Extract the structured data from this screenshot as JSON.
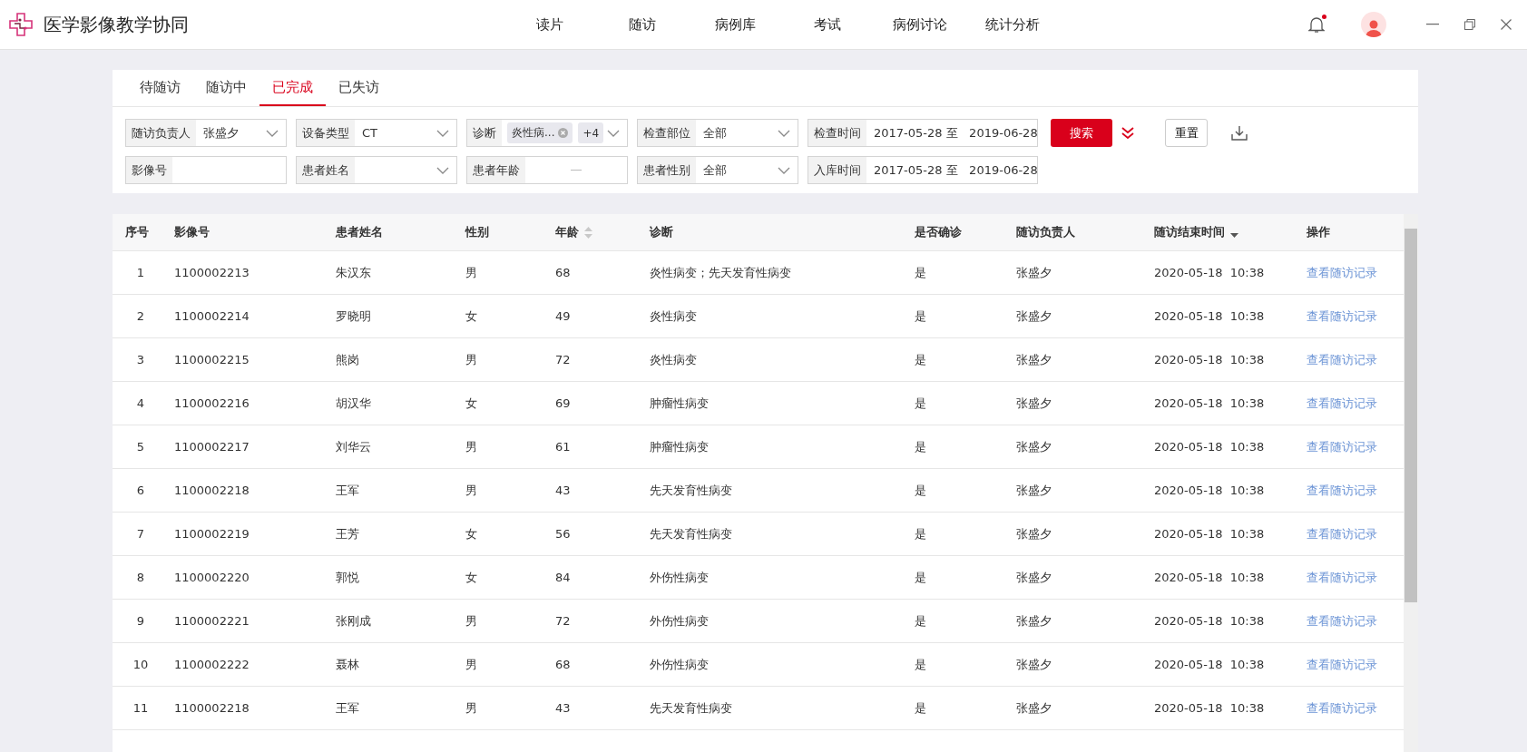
{
  "app": {
    "title": "医学影像教学协同"
  },
  "nav": [
    {
      "label": "读片",
      "selected": false
    },
    {
      "label": "随访",
      "selected": false
    },
    {
      "label": "病例库",
      "selected": false
    },
    {
      "label": "考试",
      "selected": false
    },
    {
      "label": "病例讨论",
      "selected": false
    },
    {
      "label": "统计分析",
      "selected": false
    }
  ],
  "notifications": {
    "unread": true
  },
  "tabs": [
    {
      "label": "待随访",
      "selected": false
    },
    {
      "label": "随访中",
      "selected": false
    },
    {
      "label": "已完成",
      "selected": true
    },
    {
      "label": "已失访",
      "selected": false
    }
  ],
  "filters": [
    [
      {
        "kind": "select",
        "label": "随访负责人",
        "value": "张盛夕"
      },
      {
        "kind": "select",
        "label": "设备类型",
        "value": "CT"
      },
      {
        "kind": "tags",
        "label": "诊断",
        "tags": [
          "炎性病..."
        ],
        "more": "+4"
      },
      {
        "kind": "select",
        "label": "检查部位",
        "value": "全部"
      },
      {
        "kind": "date_range",
        "label": "检查时间",
        "from": "2017-05-28",
        "sep": "至",
        "to": "2019-06-28"
      }
    ],
    [
      {
        "kind": "input",
        "label": "影像号"
      },
      {
        "kind": "select",
        "label": "患者姓名"
      },
      {
        "kind": "range",
        "label": "患者年龄"
      },
      {
        "kind": "select",
        "label": "患者性别",
        "value": "全部"
      },
      {
        "kind": "date_range",
        "label": "入库时间",
        "from": "2017-05-28",
        "sep": "至",
        "to": "2019-06-28"
      }
    ]
  ],
  "actions": {
    "search": "搜索",
    "reset": "重置"
  },
  "table": {
    "columns": [
      {
        "label": "序号",
        "sortable": false
      },
      {
        "label": "影像号",
        "sortable": false
      },
      {
        "label": "患者姓名",
        "sortable": false
      },
      {
        "label": "性别",
        "sortable": false
      },
      {
        "label": "年龄",
        "sortable": true,
        "sorted_desc": false
      },
      {
        "label": "诊断",
        "sortable": false
      },
      {
        "label": "是否确诊",
        "sortable": false
      },
      {
        "label": "随访负责人",
        "sortable": false
      },
      {
        "label": "随访结束时间",
        "sortable": true,
        "sorted_desc": true
      },
      {
        "label": "操作",
        "sortable": false
      }
    ],
    "rows": [
      [
        "1",
        "1100002213",
        "朱汉东",
        "男",
        "68",
        "炎性病变；先天发育性病变",
        "是",
        "张盛夕",
        "2020-05-18  10:38",
        "查看随访记录"
      ],
      [
        "2",
        "1100002214",
        "罗晓明",
        "女",
        "49",
        "炎性病变",
        "是",
        "张盛夕",
        "2020-05-18  10:38",
        "查看随访记录"
      ],
      [
        "3",
        "1100002215",
        "熊岗",
        "男",
        "72",
        "炎性病变",
        "是",
        "张盛夕",
        "2020-05-18  10:38",
        "查看随访记录"
      ],
      [
        "4",
        "1100002216",
        "胡汉华",
        "女",
        "69",
        "肿瘤性病变",
        "是",
        "张盛夕",
        "2020-05-18  10:38",
        "查看随访记录"
      ],
      [
        "5",
        "1100002217",
        "刘华云",
        "男",
        "61",
        "肿瘤性病变",
        "是",
        "张盛夕",
        "2020-05-18  10:38",
        "查看随访记录"
      ],
      [
        "6",
        "1100002218",
        "王军",
        "男",
        "43",
        "先天发育性病变",
        "是",
        "张盛夕",
        "2020-05-18  10:38",
        "查看随访记录"
      ],
      [
        "7",
        "1100002219",
        "王芳",
        "女",
        "56",
        "先天发育性病变",
        "是",
        "张盛夕",
        "2020-05-18  10:38",
        "查看随访记录"
      ],
      [
        "8",
        "1100002220",
        "郭悦",
        "女",
        "84",
        "外伤性病变",
        "是",
        "张盛夕",
        "2020-05-18  10:38",
        "查看随访记录"
      ],
      [
        "9",
        "1100002221",
        "张刚成",
        "男",
        "72",
        "外伤性病变",
        "是",
        "张盛夕",
        "2020-05-18  10:38",
        "查看随访记录"
      ],
      [
        "10",
        "1100002222",
        "聂林",
        "男",
        "68",
        "外伤性病变",
        "是",
        "张盛夕",
        "2020-05-18  10:38",
        "查看随访记录"
      ],
      [
        "11",
        "1100002218",
        "王军",
        "男",
        "43",
        "先天发育性病变",
        "是",
        "张盛夕",
        "2020-05-18  10:38",
        "查看随访记录"
      ]
    ]
  }
}
